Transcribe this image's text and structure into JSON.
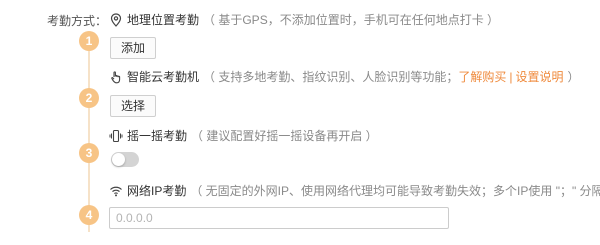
{
  "label": "考勤方式：",
  "rows": [
    {
      "number": "1",
      "icon": "location-pin-icon",
      "title": "地理位置考勤",
      "desc": "（ 基于GPS，不添加位置时，手机可在任何地点打卡 ）",
      "button": "添加"
    },
    {
      "number": "2",
      "icon": "hand-touch-icon",
      "title": "智能云考勤机",
      "desc": "（ 支持多地考勤、指纹识别、人脸识别等功能；",
      "link1": "了解购买",
      "sep": "|",
      "link2": "设置说明",
      "desc_end": "）",
      "button": "选择"
    },
    {
      "number": "3",
      "icon": "phone-shake-icon",
      "title": "摇一摇考勤",
      "desc": "（ 建议配置好摇一摇设备再开启 ）",
      "toggle_on": false
    },
    {
      "number": "4",
      "icon": "wifi-icon",
      "title": "网络IP考勤",
      "desc": "（ 无固定的外网IP、使用网络代理均可能导致考勤失效；多个IP使用 \"；\" 分隔 ）",
      "placeholder": "0.0.0.0"
    }
  ],
  "colors": {
    "accent": "#ef8a3c",
    "badge": "#f7c486"
  }
}
